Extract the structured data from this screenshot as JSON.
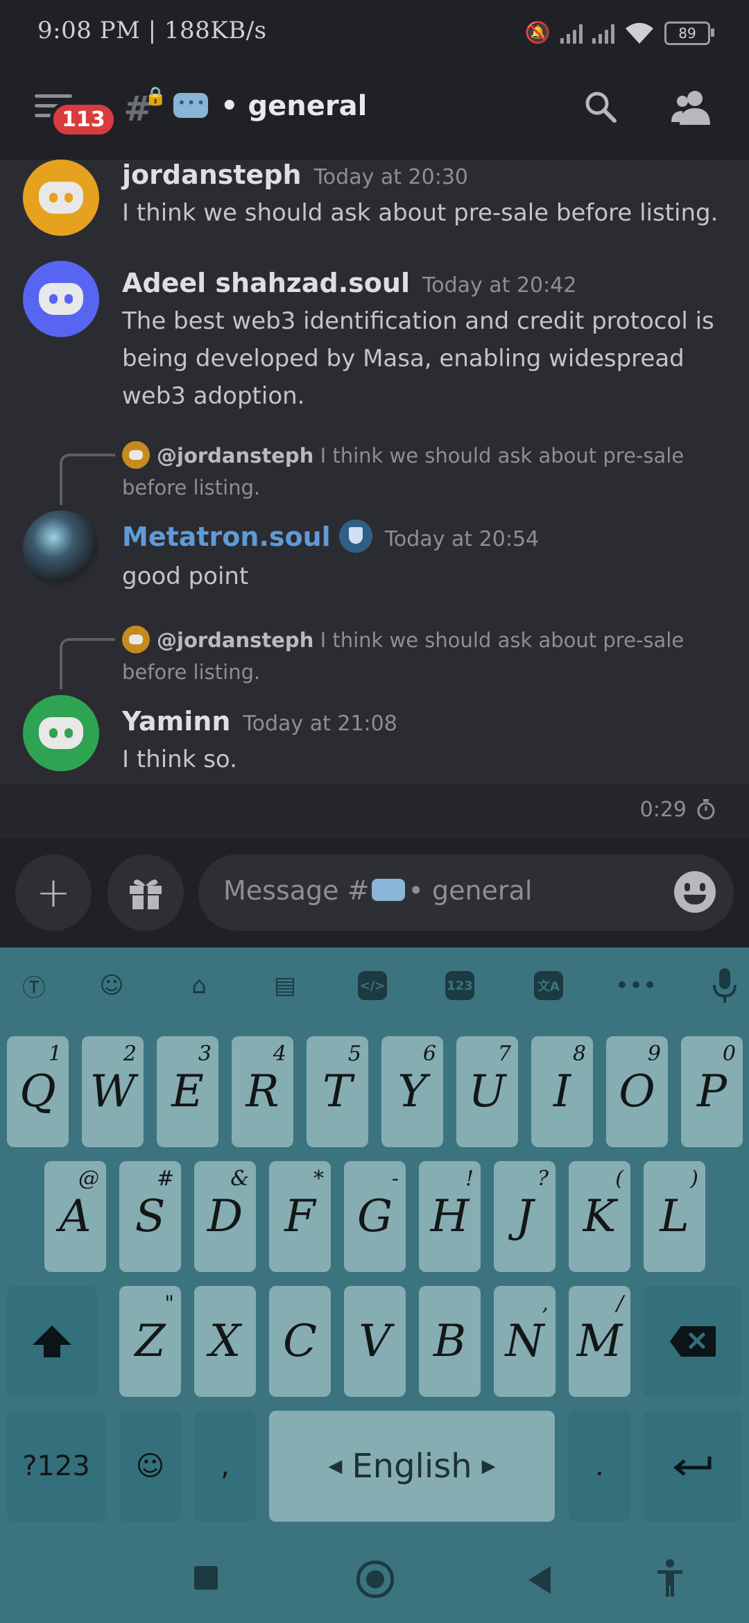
{
  "status_bar": {
    "time_and_speed": "9:08 PM | 188KB/s",
    "battery": "89"
  },
  "header": {
    "unread_badge": "113",
    "channel_name": "• general"
  },
  "messages": [
    {
      "author": "jordansteph",
      "timestamp": "Today at 20:30",
      "text": "I think we should ask about pre-sale before listing.",
      "avatar_color": "#e6a11e"
    },
    {
      "author": "Adeel shahzad.soul",
      "timestamp": "Today at 20:42",
      "text": "The best web3 identification and credit protocol is being developed by Masa, enabling widespread web3 adoption.",
      "avatar_color": "#5865f2"
    },
    {
      "author": "Metatron.soul",
      "timestamp": "Today at 20:54",
      "text": "good point",
      "author_color": "#5f9bd6",
      "reply": {
        "mention": "@jordansteph",
        "text": "I think we should ask about pre-sale before listing."
      }
    },
    {
      "author": "Yaminn",
      "timestamp": "Today at 21:08",
      "text": "I think so.",
      "avatar_color": "#2ea352",
      "reply": {
        "mention": "@jordansteph",
        "text": "I think we should ask about pre-sale before listing."
      }
    }
  ],
  "timer": {
    "label": "0:29"
  },
  "composer": {
    "placeholder_prefix": "Message #",
    "placeholder_channel": "• general"
  },
  "keyboard": {
    "row1": [
      {
        "key": "Q",
        "hint": "1"
      },
      {
        "key": "W",
        "hint": "2"
      },
      {
        "key": "E",
        "hint": "3"
      },
      {
        "key": "R",
        "hint": "4"
      },
      {
        "key": "T",
        "hint": "5"
      },
      {
        "key": "Y",
        "hint": "6"
      },
      {
        "key": "U",
        "hint": "7"
      },
      {
        "key": "I",
        "hint": "8"
      },
      {
        "key": "O",
        "hint": "9"
      },
      {
        "key": "P",
        "hint": "0"
      }
    ],
    "row2": [
      {
        "key": "A",
        "hint": "@"
      },
      {
        "key": "S",
        "hint": "#"
      },
      {
        "key": "D",
        "hint": "&"
      },
      {
        "key": "F",
        "hint": "*"
      },
      {
        "key": "G",
        "hint": "-"
      },
      {
        "key": "H",
        "hint": "!"
      },
      {
        "key": "J",
        "hint": "?"
      },
      {
        "key": "K",
        "hint": "("
      },
      {
        "key": "L",
        "hint": ")"
      }
    ],
    "row3": [
      {
        "key": "Z",
        "hint": "\""
      },
      {
        "key": "X",
        "hint": ""
      },
      {
        "key": "C",
        "hint": ""
      },
      {
        "key": "V",
        "hint": ""
      },
      {
        "key": "B",
        "hint": ""
      },
      {
        "key": "N",
        "hint": ","
      },
      {
        "key": "M",
        "hint": "/"
      }
    ],
    "symbols_label": "?123",
    "comma_label": ",",
    "space_label": "English",
    "period_label": ".",
    "toolbar_numbers_label": "123"
  }
}
